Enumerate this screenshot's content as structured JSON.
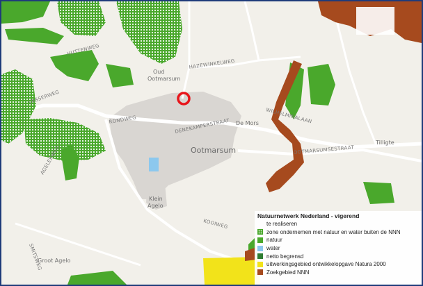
{
  "map": {
    "town_label": "Ootmarsum",
    "places": [
      "Oud",
      "Ootmarsum",
      "Klein",
      "Agelo",
      "Groot Agelo",
      "De Mors",
      "Tilligte"
    ],
    "roads": [
      "Vasserweg",
      "Rondweg",
      "Denekamperstraat",
      "Hazewinkelweg",
      "Huttenweg",
      "Ootmarsumsestraat",
      "Wilhelminalaan",
      "Smitsweg",
      "Kooiweg",
      "Agelerweg"
    ],
    "marker": {
      "color": "#e8161b"
    },
    "colors": {
      "natuur": "#4aa82c",
      "zoekgebied": "#a64a1e",
      "natura2000": "#f2e31a",
      "water": "#8cc8ee"
    }
  },
  "legend": {
    "title": "Natuurnetwerk Nederland - vigerend",
    "items": [
      {
        "label": "te realiseren",
        "swatch": "none",
        "color": ""
      },
      {
        "label": "zone ondernemen met natuur en water buiten de NNN",
        "swatch": "hatch",
        "color": "#4aa82c"
      },
      {
        "label": "natuur",
        "swatch": "solid",
        "color": "#4aa82c"
      },
      {
        "label": "water",
        "swatch": "solid",
        "color": "#8cc8ee"
      },
      {
        "label": "netto begrensd",
        "swatch": "solid",
        "color": "#2e7d32"
      },
      {
        "label": "uitwerkingsgebied ontwikkelopgave Natura 2000",
        "swatch": "solid",
        "color": "#f2e31a"
      },
      {
        "label": "Zoekgebied NNN",
        "swatch": "solid",
        "color": "#a64a1e"
      }
    ]
  }
}
